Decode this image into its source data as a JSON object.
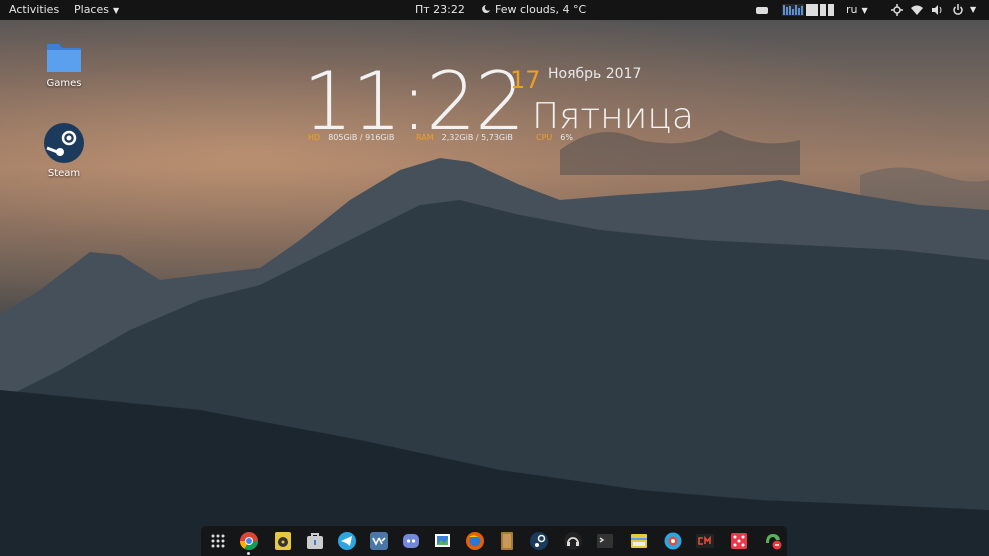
{
  "topbar": {
    "activities": "Activities",
    "places": "Places",
    "clock": "Пт 23:22",
    "weather": "Few clouds, 4 °C",
    "language": "ru"
  },
  "desktop": {
    "icons": [
      {
        "label": "Games",
        "icon": "folder-icon"
      },
      {
        "label": "Steam",
        "icon": "steam-icon"
      }
    ]
  },
  "conky": {
    "time": "11:22",
    "day": "17",
    "month_year": "Ноябрь 2017",
    "weekday": "Пятница",
    "stats": [
      {
        "key": "HD",
        "value": "805GiB / 916GiB"
      },
      {
        "key": "RAM",
        "value": "2,32GiB / 5,73GiB"
      },
      {
        "key": "CPU",
        "value": "6%"
      }
    ]
  },
  "dock": {
    "items": [
      "app-grid-icon",
      "chrome-icon",
      "rhythmbox-icon",
      "software-store-icon",
      "telegram-icon",
      "vk-icon",
      "discord-icon",
      "image-viewer-icon",
      "firefox-icon",
      "notes-icon",
      "steam-icon",
      "headset-icon",
      "terminal-icon",
      "files-icon",
      "settings-icon",
      "cm-icon",
      "dice-icon",
      "update-icon"
    ]
  },
  "colors": {
    "accent": "#f0a020",
    "topbar": "#141414",
    "dock": "#141414"
  }
}
